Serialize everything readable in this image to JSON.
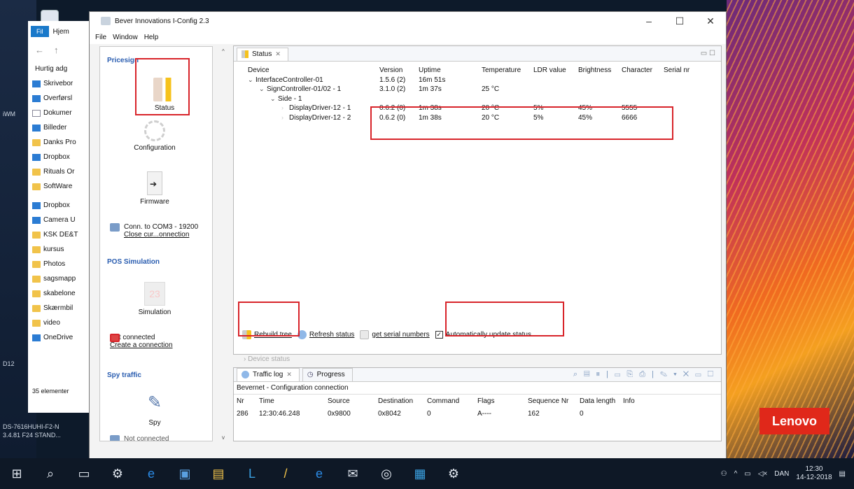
{
  "desktop": {
    "left_label_1": "iWM",
    "left_label_2": "D12",
    "bottom_left_1": "DS-7616HUHI-F2-N",
    "bottom_left_2": "3.4.81 F24 STAND...",
    "brand": "Lenovo"
  },
  "explorer": {
    "file_tab": "Fil",
    "home_tab": "Hjem",
    "items": [
      {
        "label": "Hurtig adg",
        "icon": "star-icon"
      },
      {
        "label": "Skrivebor",
        "icon": "desktop-icon"
      },
      {
        "label": "Overførsl",
        "icon": "download-icon"
      },
      {
        "label": "Dokumer",
        "icon": "document-icon"
      },
      {
        "label": "Billeder",
        "icon": "pictures-icon"
      },
      {
        "label": "Danks Pro",
        "icon": "folder-icon"
      },
      {
        "label": "Dropbox",
        "icon": "dropbox-icon"
      },
      {
        "label": "Rituals Or",
        "icon": "folder-icon"
      },
      {
        "label": "SoftWare",
        "icon": "folder-icon"
      },
      {
        "label": "Dropbox",
        "icon": "dropbox-icon"
      },
      {
        "label": "Camera U",
        "icon": "camera-icon"
      },
      {
        "label": "KSK DE&T",
        "icon": "shared-folder-icon"
      },
      {
        "label": "kursus",
        "icon": "folder-icon"
      },
      {
        "label": "Photos",
        "icon": "folder-icon"
      },
      {
        "label": "sagsmapp",
        "icon": "folder-icon"
      },
      {
        "label": "skabelone",
        "icon": "folder-icon"
      },
      {
        "label": "Skærmbil",
        "icon": "folder-icon"
      },
      {
        "label": "video",
        "icon": "folder-icon"
      },
      {
        "label": "OneDrive",
        "icon": "cloud-icon"
      }
    ],
    "count": "35 elementer"
  },
  "window": {
    "title": "Bever Innovations I-Config 2.3",
    "menu": [
      "File",
      "Window",
      "Help"
    ]
  },
  "nav": {
    "section_pricesign": "Pricesign",
    "status_label": "Status",
    "configuration_label": "Configuration",
    "firmware_label": "Firmware",
    "conn_text": "Conn. to COM3 - 19200",
    "close_conn_link": "Close cur...onnection",
    "section_pos": "POS Simulation",
    "simulation_label": "Simulation",
    "not_connected": "Not connected",
    "create_conn_link": "Create a connection",
    "section_spy": "Spy traffic",
    "spy_label": "Spy",
    "bottom_partial": "Not connected"
  },
  "status_view": {
    "tab_label": "Status",
    "columns": [
      "Device",
      "Version",
      "Uptime",
      "Temperature",
      "LDR value",
      "Brightness",
      "Character",
      "Serial nr"
    ],
    "rows": [
      {
        "indent": 0,
        "arrow": "v",
        "device": "InterfaceController-01",
        "version": "1.5.6 (2)",
        "uptime": "16m 51s",
        "temp": "",
        "ldr": "",
        "bright": "",
        "char": "",
        "serial": ""
      },
      {
        "indent": 1,
        "arrow": "v",
        "device": "SignController-01/02 - 1",
        "version": "3.1.0 (2)",
        "uptime": "1m 37s",
        "temp": "25 °C",
        "ldr": "",
        "bright": "",
        "char": "",
        "serial": ""
      },
      {
        "indent": 2,
        "arrow": "v",
        "device": "Side - 1",
        "version": "",
        "uptime": "",
        "temp": "",
        "ldr": "",
        "bright": "",
        "char": "",
        "serial": ""
      },
      {
        "indent": 3,
        "arrow": ">",
        "device": "DisplayDriver-12 - 1",
        "version": "0.6.2 (0)",
        "uptime": "1m 38s",
        "temp": "20 °C",
        "ldr": "5%",
        "bright": "45%",
        "char": "5555",
        "serial": ""
      },
      {
        "indent": 3,
        "arrow": ">",
        "device": "DisplayDriver-12 - 2",
        "version": "0.6.2 (0)",
        "uptime": "1m 38s",
        "temp": "20 °C",
        "ldr": "5%",
        "bright": "45%",
        "char": "6666",
        "serial": ""
      }
    ],
    "rebuild_tree": "Rebuild tree",
    "refresh_status": "Refresh status",
    "get_serial": "get serial numbers",
    "auto_update": "Automatically update status",
    "auto_update_checked": true,
    "device_status": "Device status"
  },
  "traffic": {
    "tab_log": "Traffic log",
    "tab_progress": "Progress",
    "connection_title": "Bevernet - Configuration connection",
    "columns": [
      "Nr",
      "Time",
      "Source",
      "Destination",
      "Command",
      "Flags",
      "Sequence Nr",
      "Data length",
      "Info"
    ],
    "rows": [
      {
        "nr": "286",
        "time": "12:30:46.248",
        "source": "0x9800",
        "destination": "0x8042",
        "command": "0",
        "flags": "A----",
        "seq": "162",
        "len": "0",
        "info": ""
      }
    ]
  },
  "taskbar": {
    "lang": "DAN",
    "time": "12:30",
    "date": "14-12-2018"
  },
  "colors": {
    "annotation_red": "#d8242a",
    "section_blue": "#2a5db0",
    "accent_yellow": "#f6c21c"
  }
}
